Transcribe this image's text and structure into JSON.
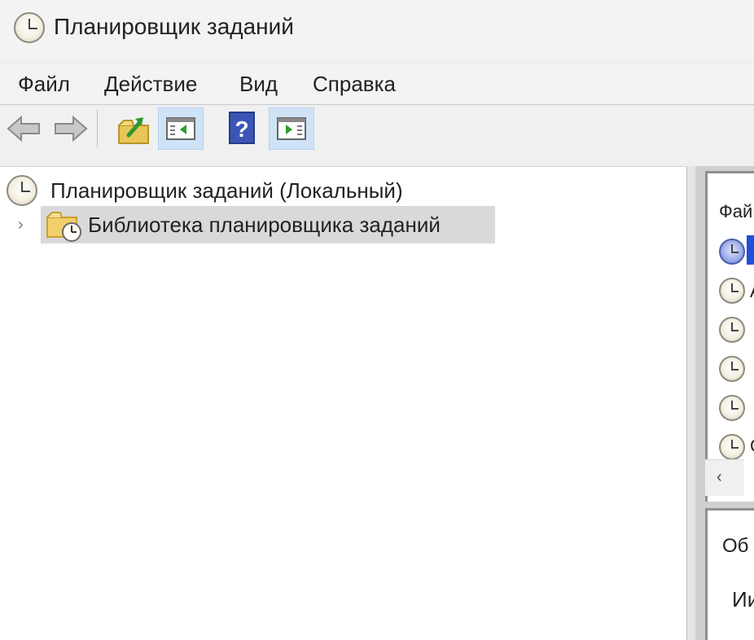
{
  "window": {
    "title": "Планировщик заданий"
  },
  "menu": {
    "items": [
      "Файл",
      "Действие",
      "Вид",
      "Справка"
    ]
  },
  "toolbar": {
    "buttons": [
      {
        "name": "back-arrow-icon"
      },
      {
        "name": "forward-arrow-icon"
      },
      {
        "name": "folder-up-icon"
      },
      {
        "name": "show-hide-console-tree-icon",
        "active": true
      },
      {
        "name": "help-icon"
      },
      {
        "name": "show-hide-action-pane-icon",
        "active": true
      }
    ]
  },
  "tree": {
    "root_label": "Планировщик заданий (Локальный)",
    "child_label": "Библиотека планировщика заданий",
    "expander": "›"
  },
  "right_pane": {
    "header": "Фай",
    "rows": [
      "",
      "А",
      "",
      "",
      "",
      "С"
    ],
    "scroll_left": "‹",
    "bottom_label1": "Об",
    "bottom_label2": "Ии"
  },
  "colors": {
    "selection": "#d9d9d9",
    "toolbar_active": "#cfe3f7",
    "list_selection": "#1f4ed8"
  }
}
